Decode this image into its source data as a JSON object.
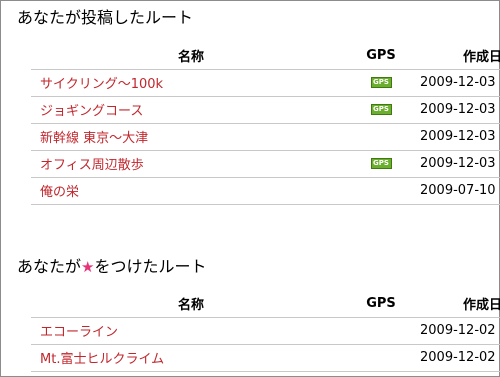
{
  "posted": {
    "title": "あなたが投稿したルート",
    "headers": {
      "name": "名称",
      "gps": "GPS",
      "date": "作成日"
    },
    "rows": [
      {
        "name": "サイクリング～100k",
        "gps": true,
        "date": "2009-12-03"
      },
      {
        "name": "ジョギングコース",
        "gps": true,
        "date": "2009-12-03"
      },
      {
        "name": "新幹線 東京～大津",
        "gps": false,
        "date": "2009-12-03"
      },
      {
        "name": "オフィス周辺散歩",
        "gps": true,
        "date": "2009-12-03"
      },
      {
        "name": "俺の栄",
        "gps": false,
        "date": "2009-07-10"
      }
    ]
  },
  "starred": {
    "title_before": "あなたが",
    "star": "★",
    "title_after": "をつけたルート",
    "headers": {
      "name": "名称",
      "gps": "GPS",
      "date": "作成日"
    },
    "rows": [
      {
        "name": "エコーライン",
        "gps": false,
        "date": "2009-12-02"
      },
      {
        "name": "Mt.富士ヒルクライム",
        "gps": false,
        "date": "2009-12-02"
      }
    ]
  },
  "gps_badge_label": "GPS",
  "colors": {
    "link": "#c1272d",
    "star": "#e8337a",
    "gps_badge": "#6cae2d"
  }
}
